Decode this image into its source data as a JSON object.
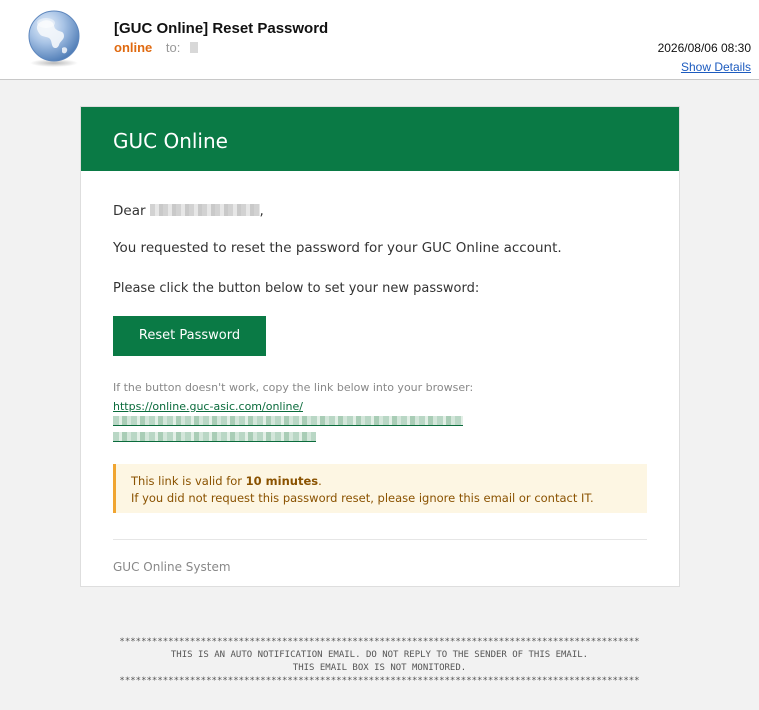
{
  "header": {
    "subject": "[GUC Online] Reset Password",
    "sender": "online",
    "to_label": "to:",
    "date": "2026/08/06 08:30",
    "show_details": "Show Details",
    "avatar_icon": "globe-icon"
  },
  "email": {
    "brand_title": "GUC Online",
    "greeting_prefix": "Dear",
    "greeting_suffix": ",",
    "paragraph1": "You requested to reset the password for your GUC Online account.",
    "paragraph2": "Please click the button below to set your new password:",
    "button_label": "Reset Password",
    "fallback_note": "If the button doesn't work, copy the link below into your browser:",
    "link_prefix": "https://online.guc-asic.com/online/",
    "notice_line1_prefix": "This link is valid for",
    "notice_line1_bold": "10 minutes",
    "notice_line1_suffix": ".",
    "notice_line2": "If you did not request this password reset, please ignore this email or contact IT.",
    "signature": "GUC Online System"
  },
  "auto_notice": {
    "stars": "************************************************************************************************",
    "line1": "THIS IS AN AUTO NOTIFICATION EMAIL. DO NOT REPLY TO THE SENDER OF THIS EMAIL.",
    "line2": "THIS EMAIL BOX IS NOT MONITORED."
  },
  "colors": {
    "brand_green": "#0a7a45",
    "sender_orange": "#e06a10",
    "link_blue": "#1c5bbf",
    "notice_bg": "#fdf6e3",
    "notice_border": "#f0a531"
  }
}
